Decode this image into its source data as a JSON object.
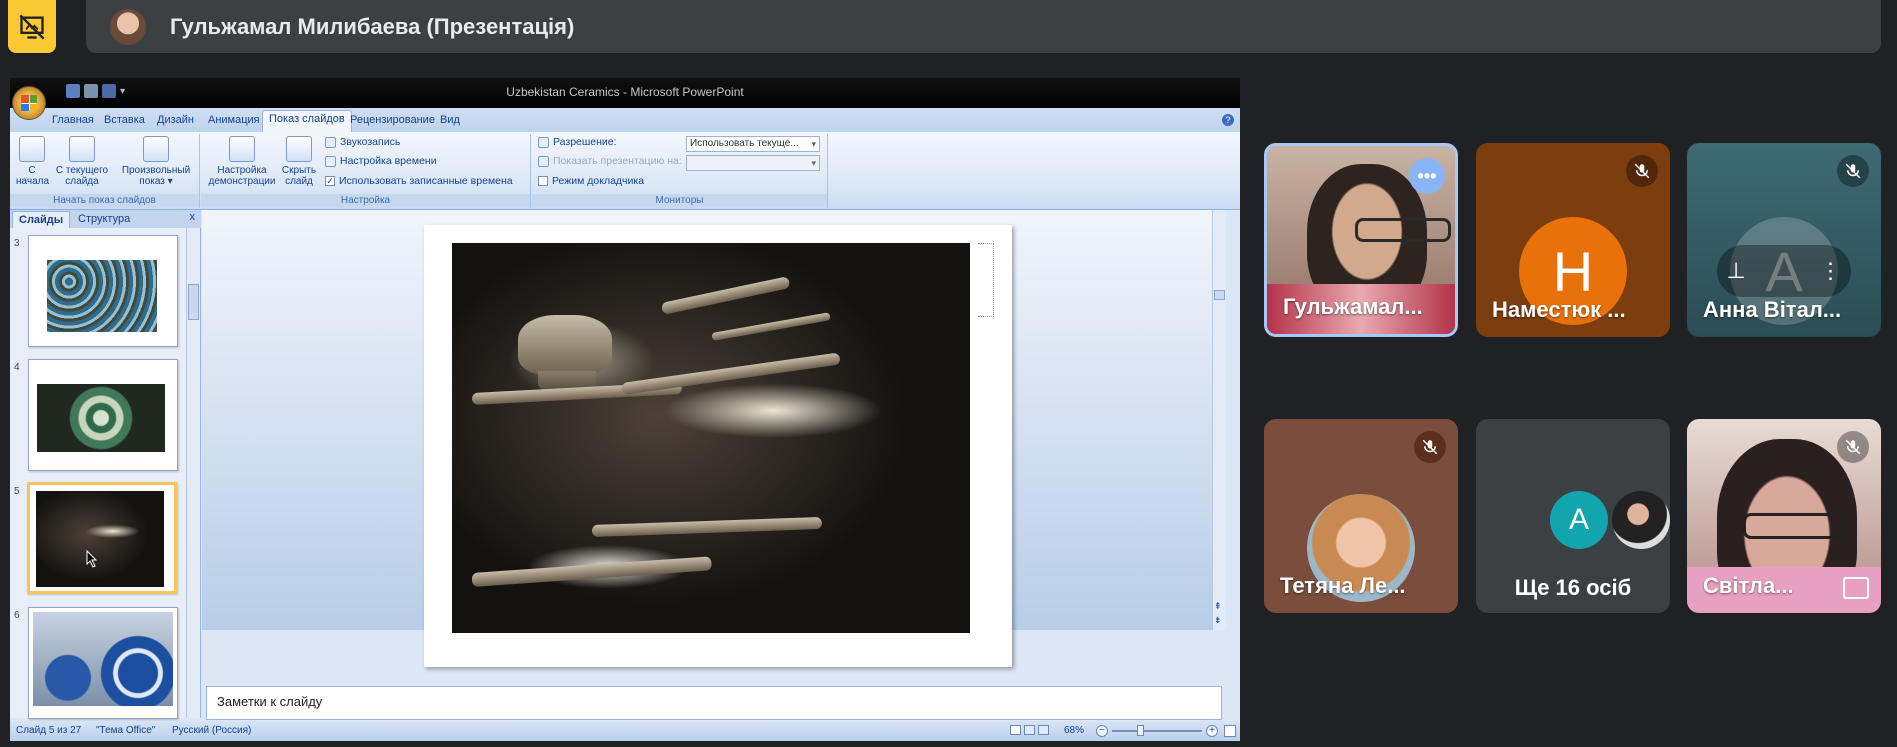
{
  "meeting": {
    "presenter_title": "Гульжамал Милибаева (Презентація)"
  },
  "powerpoint": {
    "window_title": "Uzbekistan Ceramics - Microsoft PowerPoint",
    "tabs": [
      "Главная",
      "Вставка",
      "Дизайн",
      "Анимация",
      "Показ слайдов",
      "Рецензирование",
      "Вид"
    ],
    "active_tab": "Показ слайдов",
    "ribbon": {
      "from_start": "С\nначала",
      "from_current": "С текущего\nслайда",
      "custom_show": "Произвольный\nпоказ",
      "group_start": "Начать показ слайдов",
      "setup_show": "Настройка\nдемонстрации",
      "hide_slide": "Скрыть\nслайд",
      "record_audio": "Звукозапись",
      "rehearse_timings": "Настройка времени",
      "use_timings": "Использовать записанные времена",
      "group_setup": "Настройка",
      "resolution_label": "Разрешение:",
      "resolution_value": "Использовать текуще...",
      "show_on_label": "Показать презентацию на:",
      "presenter_view": "Режим докладчика",
      "group_monitors": "Мониторы"
    },
    "pane_tabs": [
      "Слайды",
      "Структура"
    ],
    "pane_close": "x",
    "thumbnails": [
      {
        "num": "3"
      },
      {
        "num": "4"
      },
      {
        "num": "5"
      },
      {
        "num": "6"
      }
    ],
    "notes_placeholder": "Заметки к слайду",
    "status": {
      "slide_info": "Слайд 5 из 27",
      "theme": "\"Тема Office\"",
      "language": "Русский (Россия)",
      "zoom": "68%"
    }
  },
  "participants": [
    {
      "name": "Гульжамал...",
      "type": "video",
      "speaking": true
    },
    {
      "name": "Наместюк ...",
      "initial": "Н",
      "color": "#e8710a",
      "muted": true
    },
    {
      "name": "Анна Вітал...",
      "initial": "A",
      "muted": true
    },
    {
      "name": "Тетяна Ле...",
      "type": "photo",
      "muted": true
    },
    {
      "name": "Ще 16 осіб",
      "initial": "A",
      "type": "overflow"
    },
    {
      "name": "Світла...",
      "type": "video",
      "muted": true
    }
  ]
}
